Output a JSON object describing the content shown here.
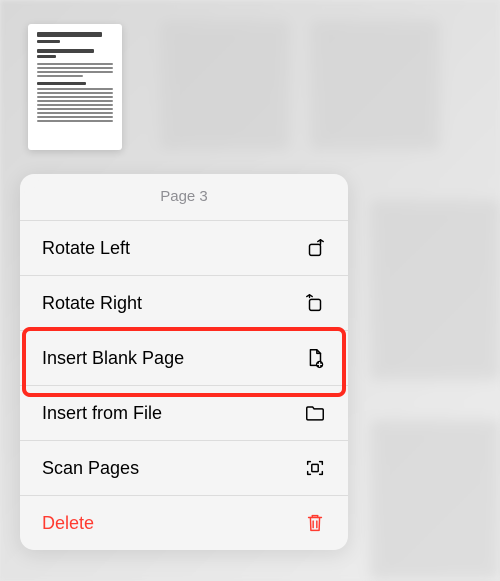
{
  "menu": {
    "title": "Page 3",
    "items": [
      {
        "label": "Rotate Left",
        "icon": "rotate-left-icon"
      },
      {
        "label": "Rotate Right",
        "icon": "rotate-right-icon"
      },
      {
        "label": "Insert Blank Page",
        "icon": "insert-blank-page-icon"
      },
      {
        "label": "Insert from File",
        "icon": "folder-icon"
      },
      {
        "label": "Scan Pages",
        "icon": "scan-icon"
      },
      {
        "label": "Delete",
        "icon": "trash-icon",
        "destructive": true
      }
    ]
  },
  "highlighted_index": 2
}
